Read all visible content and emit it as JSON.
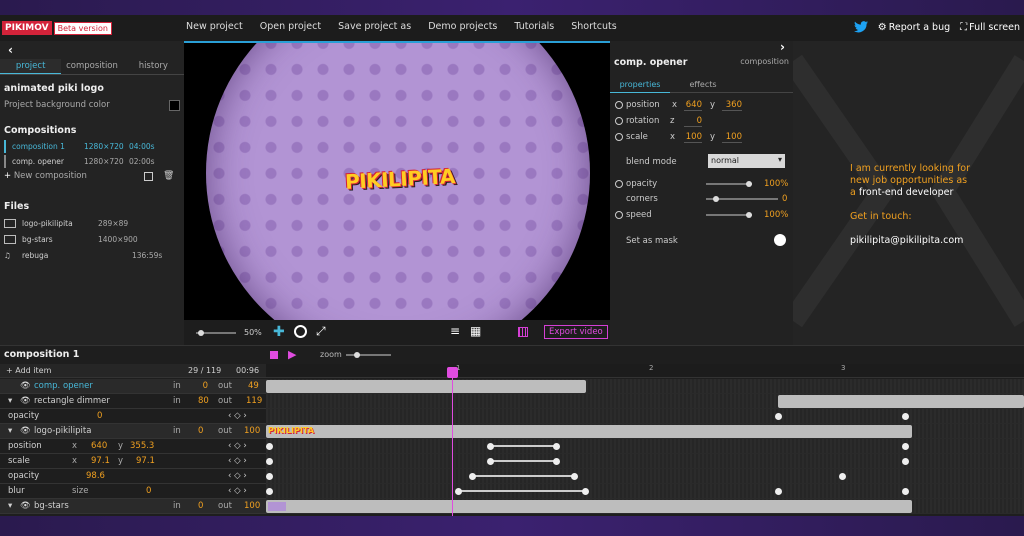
{
  "topbar": {
    "logo": "PIKIMOV",
    "beta": "Beta version",
    "menu": [
      "New project",
      "Open project",
      "Save project as",
      "Demo projects",
      "Tutorials",
      "Shortcuts"
    ],
    "report": "Report a bug",
    "fullscreen": "Full screen"
  },
  "left": {
    "tabs": [
      "project",
      "composition",
      "history"
    ],
    "project_title": "animated piki logo",
    "bg_color_label": "Project background color",
    "compositions_heading": "Compositions",
    "compositions": [
      {
        "name": "composition 1",
        "size": "1280×720",
        "duration": "04:00s"
      },
      {
        "name": "comp. opener",
        "size": "1280×720",
        "duration": "02:00s"
      }
    ],
    "new_composition": "New composition",
    "files_heading": "Files",
    "files": [
      {
        "name": "logo-pikilipita",
        "info": "289×89"
      },
      {
        "name": "bg-stars",
        "info": "1400×900"
      },
      {
        "name": "rebuga",
        "info": "136:59s"
      }
    ]
  },
  "viewport": {
    "logo_text": "PIKILIPITA",
    "zoom": "50%",
    "export": "Export video"
  },
  "props": {
    "title": "comp. opener",
    "type": "composition",
    "tabs": [
      "properties",
      "effects"
    ],
    "position": {
      "label": "position",
      "x": "640",
      "y": "360"
    },
    "rotation": {
      "label": "rotation",
      "z": "0"
    },
    "scale": {
      "label": "scale",
      "x": "100",
      "y": "100"
    },
    "blend_label": "blend mode",
    "blend_value": "normal",
    "opacity": {
      "label": "opacity",
      "value": "100%"
    },
    "corners": {
      "label": "corners",
      "value": "0"
    },
    "speed": {
      "label": "speed",
      "value": "100%"
    },
    "mask_label": "Set as mask"
  },
  "info": {
    "line1": "I am currently looking for",
    "line2": "new job opportunities as",
    "line3a": "a",
    "line3b": "front-end developer",
    "touch": "Get in touch:",
    "email": "pikilipita@pikilipita.com"
  },
  "timeline": {
    "title": "composition 1",
    "zoom_label": "zoom",
    "add_item": "Add item",
    "frame": "29 / 119",
    "time": "00:96",
    "ruler": [
      "1",
      "2",
      "3"
    ],
    "rows": [
      {
        "name": "comp. opener",
        "in": "0",
        "out": "49"
      },
      {
        "name": "rectangle dimmer",
        "in": "80",
        "out": "119"
      },
      {
        "name": "opacity",
        "value": "0"
      },
      {
        "name": "logo-pikilipita",
        "in": "0",
        "out": "100"
      },
      {
        "name": "position",
        "x": "640",
        "y": "355.3"
      },
      {
        "name": "scale",
        "x": "97.1",
        "y": "97.1"
      },
      {
        "name": "opacity",
        "value": "98.6"
      },
      {
        "name": "blur",
        "label": "size",
        "value": "0"
      },
      {
        "name": "bg-stars",
        "in": "0",
        "out": "100"
      }
    ],
    "in_label": "in",
    "out_label": "out",
    "x_label": "x",
    "y_label": "y"
  }
}
